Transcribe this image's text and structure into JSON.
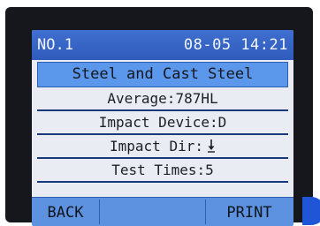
{
  "status": {
    "measurement_no": "NO.1",
    "datetime": "08-05 14:21"
  },
  "material": "Steel and Cast Steel",
  "rows": [
    {
      "text": "Average:787HL"
    },
    {
      "text": "Impact Device:D"
    },
    {
      "text": "Impact Dir:"
    },
    {
      "text": "Test Times:5"
    }
  ],
  "impact_dir_icon": "down-arrow-icon",
  "softkeys": {
    "left": "BACK",
    "right": "PRINT"
  },
  "colors": {
    "status_bar": "#2f5bbc",
    "title_bar": "#5b97ea",
    "softkey_bar": "#5c92e0",
    "screen_bg": "#e9edf3",
    "divider": "#183a7b"
  }
}
